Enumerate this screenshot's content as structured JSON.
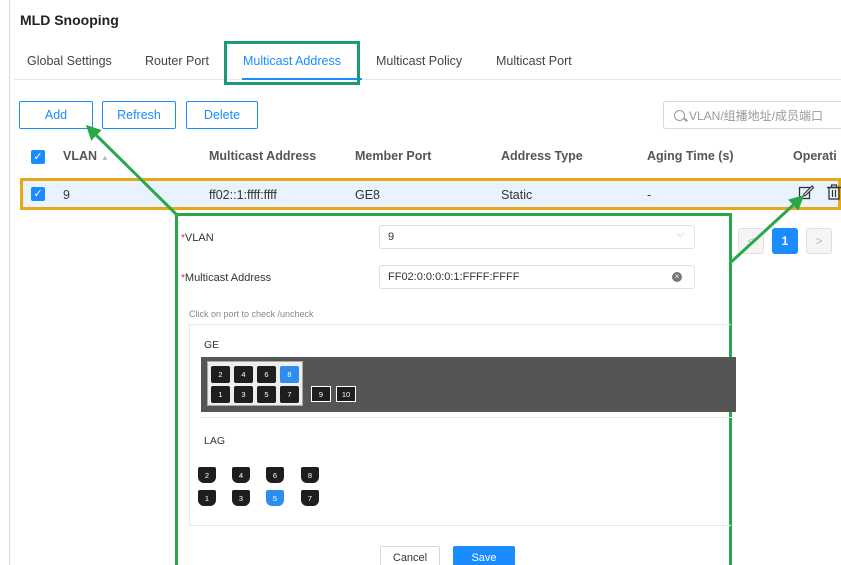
{
  "page_title": "MLD Snooping",
  "tabs": [
    {
      "label": "Global Settings"
    },
    {
      "label": "Router Port"
    },
    {
      "label": "Multicast Address"
    },
    {
      "label": "Multicast Policy"
    },
    {
      "label": "Multicast Port"
    }
  ],
  "active_tab": "Multicast Address",
  "toolbar": {
    "add_label": "Add",
    "refresh_label": "Refresh",
    "delete_label": "Delete"
  },
  "search": {
    "placeholder": "VLAN/组播地址/成员端口"
  },
  "table": {
    "columns": [
      "VLAN",
      "Multicast Address",
      "Member Port",
      "Address Type",
      "Aging Time (s)",
      "Operati"
    ],
    "rows": [
      {
        "vlan": "9",
        "multicast_address": "ff02::1:ffff:ffff",
        "member_port": "GE8",
        "address_type": "Static",
        "aging_time": "-"
      }
    ]
  },
  "pagination": {
    "current_page": "1",
    "prev": "<",
    "next": ">"
  },
  "edit_dialog": {
    "vlan_label": "VLAN",
    "vlan_value": "9",
    "multicast_label": "Multicast Address",
    "multicast_value": "FF02:0:0:0:0:1:FFFF:FFFF",
    "hint": "Click on port to check /uncheck",
    "ge_group_label": "GE",
    "ge_top_ports": [
      "2",
      "4",
      "6",
      "8"
    ],
    "ge_bottom_ports": [
      "1",
      "3",
      "5",
      "7"
    ],
    "ge_sfp_ports": [
      "9",
      "10"
    ],
    "ge_selected": "8",
    "lag_group_label": "LAG",
    "lag_top_ports": [
      "2",
      "4",
      "6",
      "8"
    ],
    "lag_bottom_ports": [
      "1",
      "3",
      "5",
      "7"
    ],
    "lag_selected": "5",
    "cancel_label": "Cancel",
    "save_label": "Save"
  },
  "colors": {
    "accent": "#1a8cff",
    "row_highlight_border": "#e6a817",
    "tab_highlight_border": "#1a9a78",
    "annotation_green": "#29a84a",
    "selected_port": "#2f8cf0"
  },
  "icons": [
    "search-icon",
    "checkbox-icon",
    "sort-icon",
    "edit-icon",
    "delete-icon",
    "chevron-down-icon",
    "clear-icon"
  ]
}
